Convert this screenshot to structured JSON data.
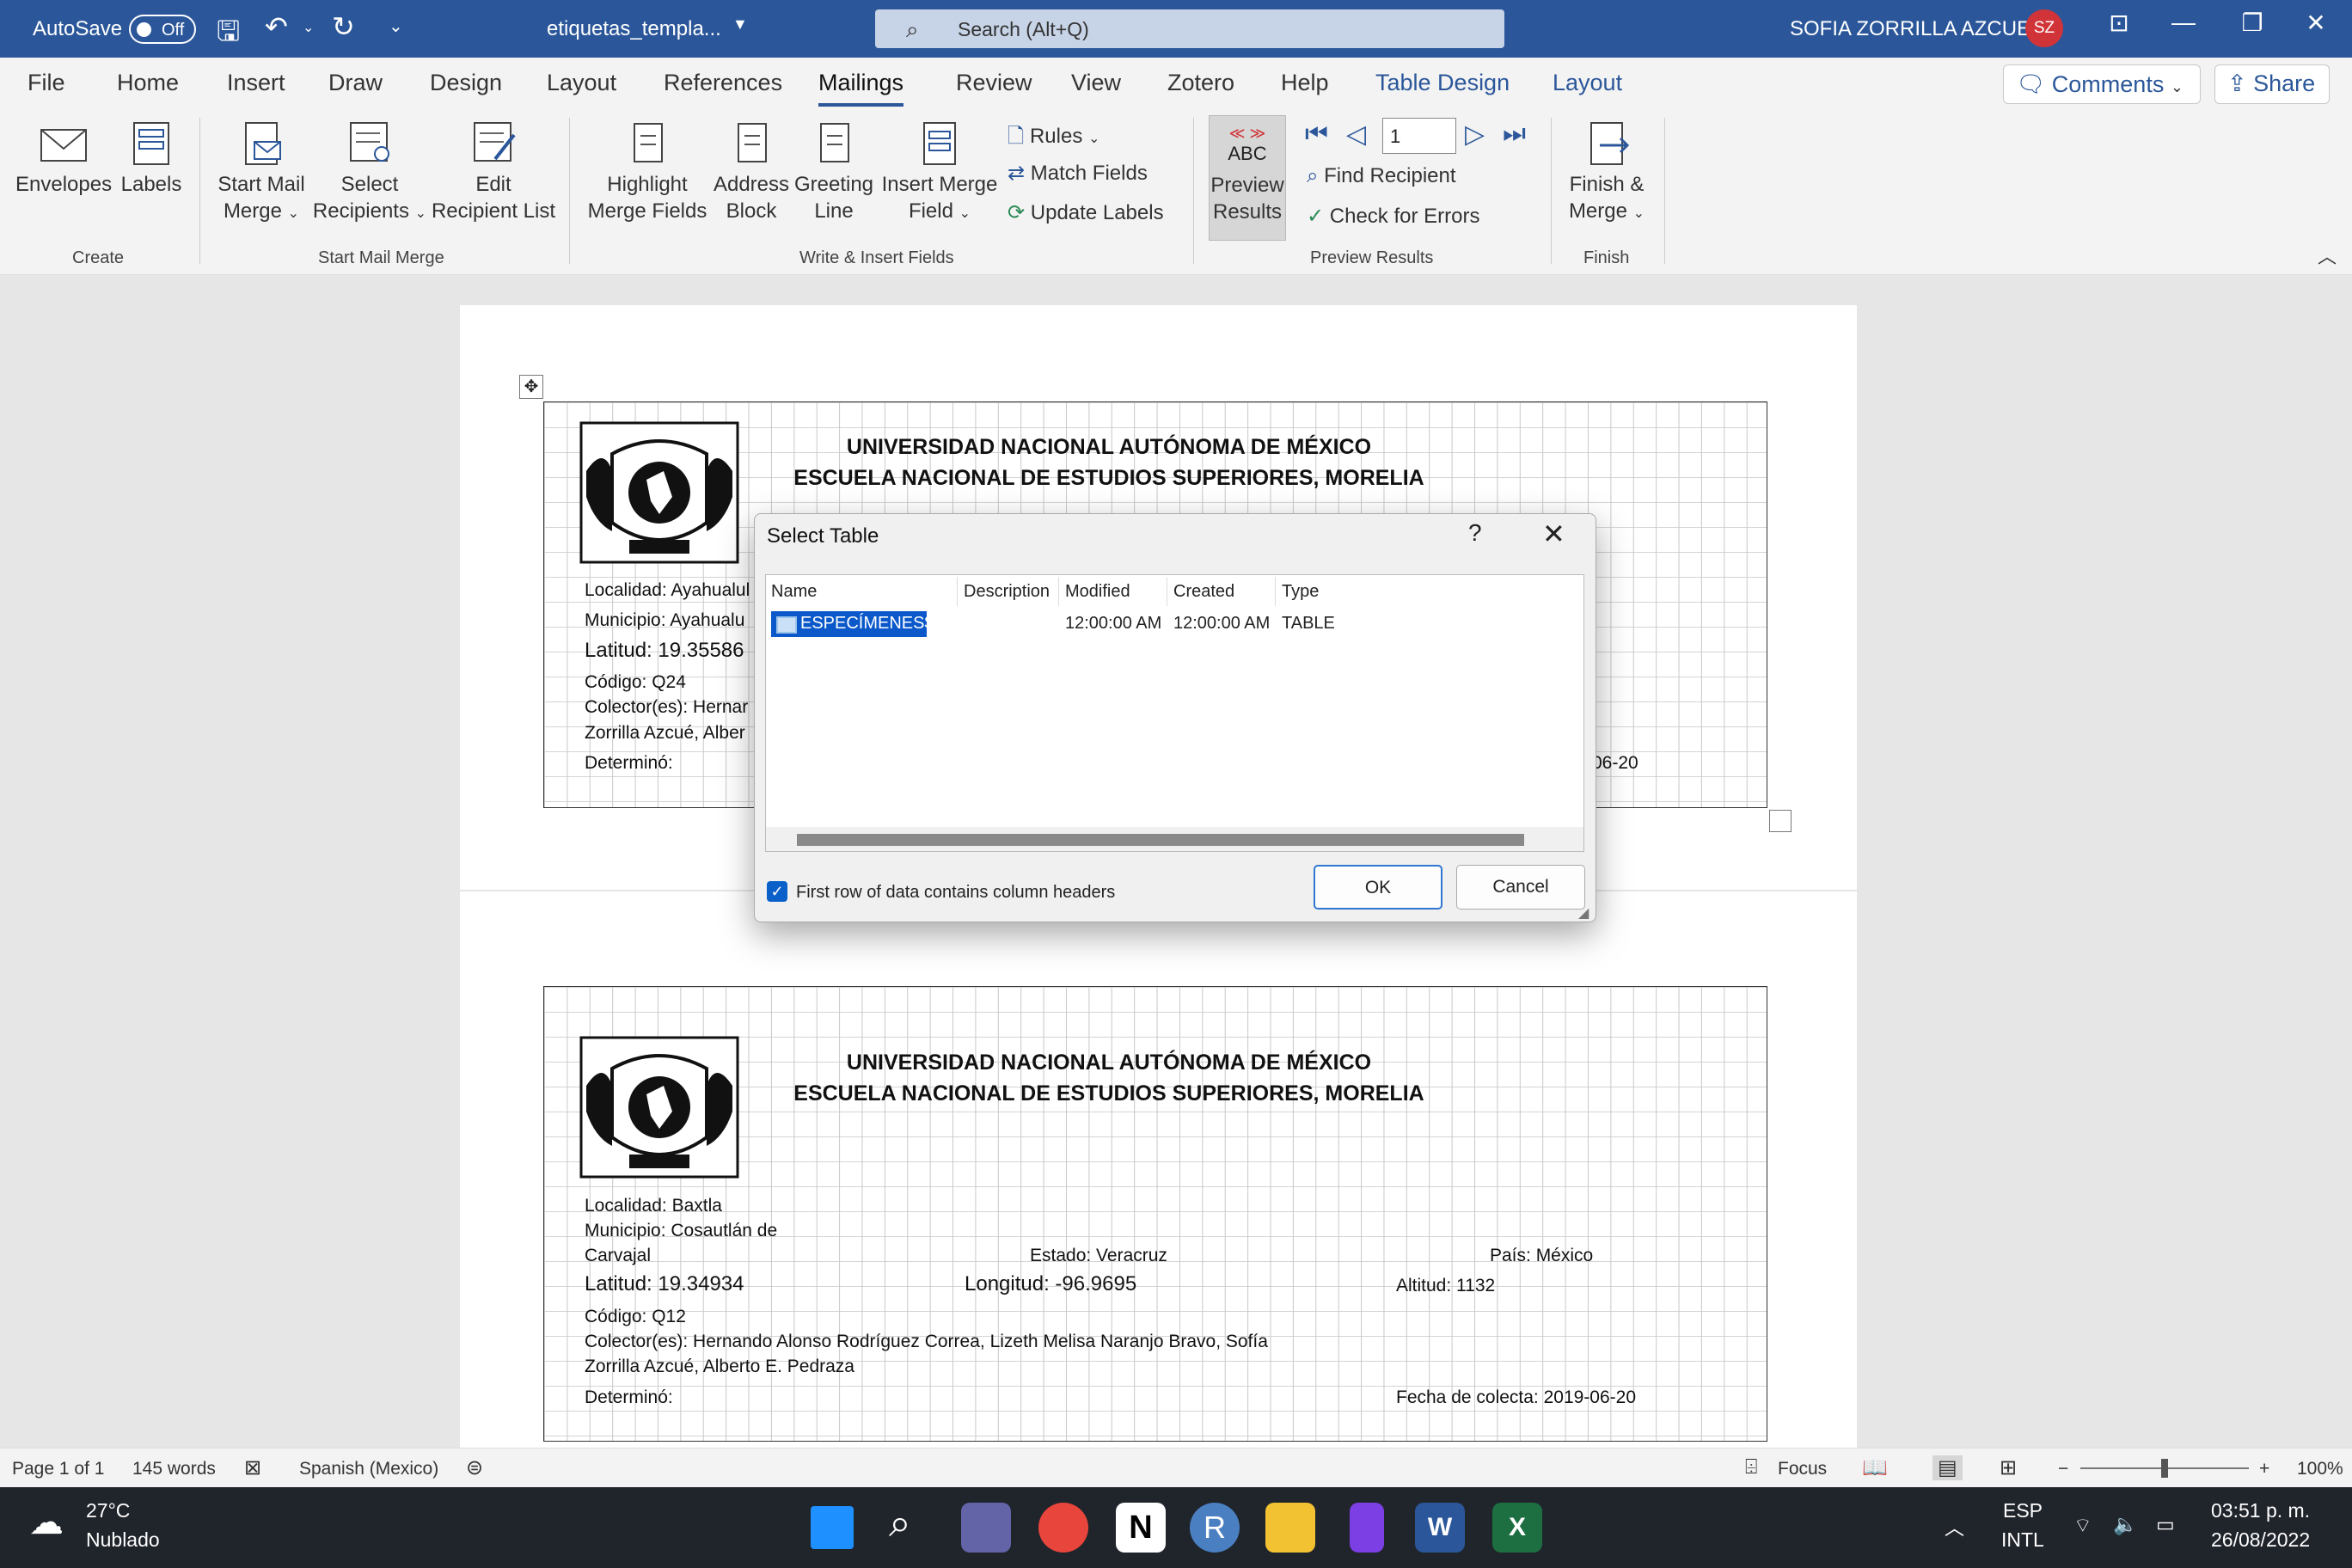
{
  "titlebar": {
    "autosave": "AutoSave",
    "autosave_state": "Off",
    "filename": "etiquetas_templa...",
    "search_placeholder": "Search (Alt+Q)",
    "user": "SOFIA ZORRILLA AZCUE",
    "initials": "SZ"
  },
  "tabs": [
    "File",
    "Home",
    "Insert",
    "Draw",
    "Design",
    "Layout",
    "References",
    "Mailings",
    "Review",
    "View",
    "Zotero",
    "Help",
    "Table Design",
    "Layout"
  ],
  "comments": "Comments",
  "share": "Share",
  "ribbon": {
    "create": {
      "envelopes": "Envelopes",
      "labels": "Labels",
      "group": "Create"
    },
    "start": {
      "start_mail_merge": [
        "Start Mail",
        "Merge"
      ],
      "select_recipients": [
        "Select",
        "Recipients"
      ],
      "edit_recipient_list": [
        "Edit",
        "Recipient List"
      ],
      "group": "Start Mail Merge"
    },
    "write": {
      "highlight": [
        "Highlight",
        "Merge Fields"
      ],
      "address_block": [
        "Address",
        "Block"
      ],
      "greeting_line": [
        "Greeting",
        "Line"
      ],
      "insert_merge_field": [
        "Insert Merge",
        "Field"
      ],
      "rules": "Rules",
      "match_fields": "Match Fields",
      "update_labels": "Update Labels",
      "group": "Write & Insert Fields"
    },
    "preview": {
      "abc": "ABC",
      "preview_results": [
        "Preview",
        "Results"
      ],
      "record": "1",
      "find_recipient": "Find Recipient",
      "check_errors": "Check for Errors",
      "group": "Preview Results"
    },
    "finish": {
      "finish_merge": [
        "Finish &",
        "Merge"
      ],
      "group": "Finish"
    }
  },
  "document": {
    "label1": {
      "univ": "UNIVERSIDAD NACIONAL AUTÓNOMA DE MÉXICO",
      "school": "ESCUELA NACIONAL DE ESTUDIOS SUPERIORES, MORELIA",
      "localidad": "Localidad: Ayahualul",
      "municipio": "Municipio: Ayahualu",
      "latitud": "Latitud:  19.35586",
      "codigo": "Código: Q24",
      "colector1": "Colector(es): Hernar",
      "colector2": "Zorrilla Azcué, Alber",
      "determino": "Determinó:",
      "fecha_frag": "06-20"
    },
    "label2": {
      "univ": "UNIVERSIDAD NACIONAL AUTÓNOMA DE MÉXICO",
      "school": "ESCUELA NACIONAL DE ESTUDIOS SUPERIORES, MORELIA",
      "localidad": "Localidad: Baxtla",
      "municipio1": "Municipio: Cosautlán de",
      "municipio2": "Carvajal",
      "estado": "Estado: Veracruz",
      "pais": "País: México",
      "latitud": "Latitud:  19.34934",
      "longitud": "Longitud: -96.9695",
      "altitud": "Altitud: 1132",
      "codigo": "Código: Q12",
      "colector1": "Colector(es): Hernando Alonso Rodríguez Correa, Lizeth Melisa Naranjo Bravo, Sofía",
      "colector2": "Zorrilla Azcué, Alberto E. Pedraza",
      "determino": "Determinó:",
      "fecha": "Fecha de colecta: 2019-06-20"
    },
    "seal_text": "UNIVERSIDAD NACIONAL AUTONOMA DE MEXICO"
  },
  "dialog": {
    "title": "Select Table",
    "help": "?",
    "columns": [
      "Name",
      "Description",
      "Modified",
      "Created",
      "Type"
    ],
    "rows": [
      {
        "name": "ESPECÍMENES$",
        "description": "",
        "modified": "12:00:00 AM",
        "created": "12:00:00 AM",
        "type": "TABLE"
      }
    ],
    "checkbox_label": "First row of data contains column headers",
    "checkbox_checked": true,
    "ok": "OK",
    "cancel": "Cancel"
  },
  "status": {
    "page": "Page 1 of 1",
    "words": "145 words",
    "language": "Spanish (Mexico)",
    "focus": "Focus",
    "zoom": "100%"
  },
  "taskbar": {
    "temp": "27°C",
    "weather": "Nublado",
    "lang1": "ESP",
    "lang2": "INTL",
    "time": "03:51 p. m.",
    "date": "26/08/2022"
  }
}
